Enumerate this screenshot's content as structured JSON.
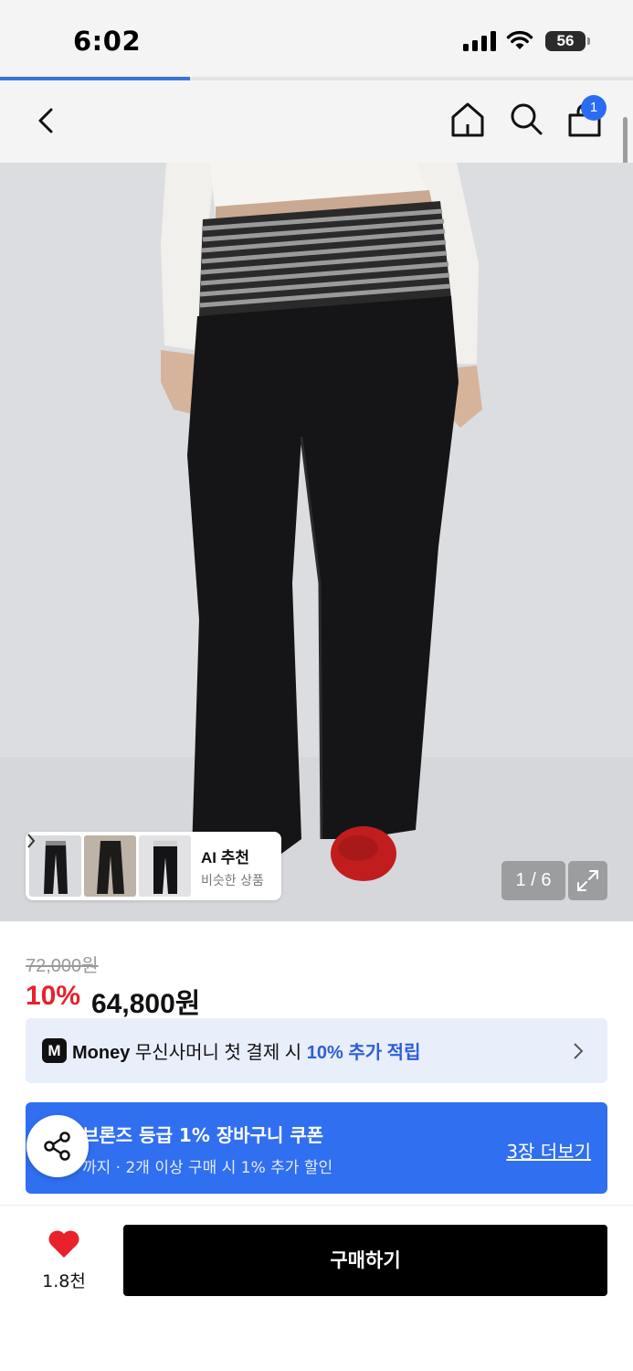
{
  "status_bar": {
    "time": "6:02",
    "battery": "56",
    "load_progress": 0.3
  },
  "nav": {
    "cart_count": "1"
  },
  "gallery": {
    "counter": "1 / 6"
  },
  "ai_recommend": {
    "title": "AI 추천",
    "subtitle": "비슷한 상품"
  },
  "price": {
    "original": "72,000원",
    "discount": "10%",
    "final": "64,800원"
  },
  "money_banner": {
    "logo": "M",
    "brand": "Money",
    "text": " 무신사머니 첫 결제 시 ",
    "highlight": "10% 추가 적립"
  },
  "coupon": {
    "title": "브론즈 등급 1% 장바구니 쿠폰",
    "subtitle": "까지 · 2개 이상 구매 시 1% 추가 할인",
    "more": "3장 더보기"
  },
  "bottom_bar": {
    "likes": "1.8천",
    "buy_label": "구매하기"
  },
  "colors": {
    "accent_blue": "#2f6ff0",
    "sale_red": "#e8212b",
    "heart_red": "#e8212b"
  }
}
